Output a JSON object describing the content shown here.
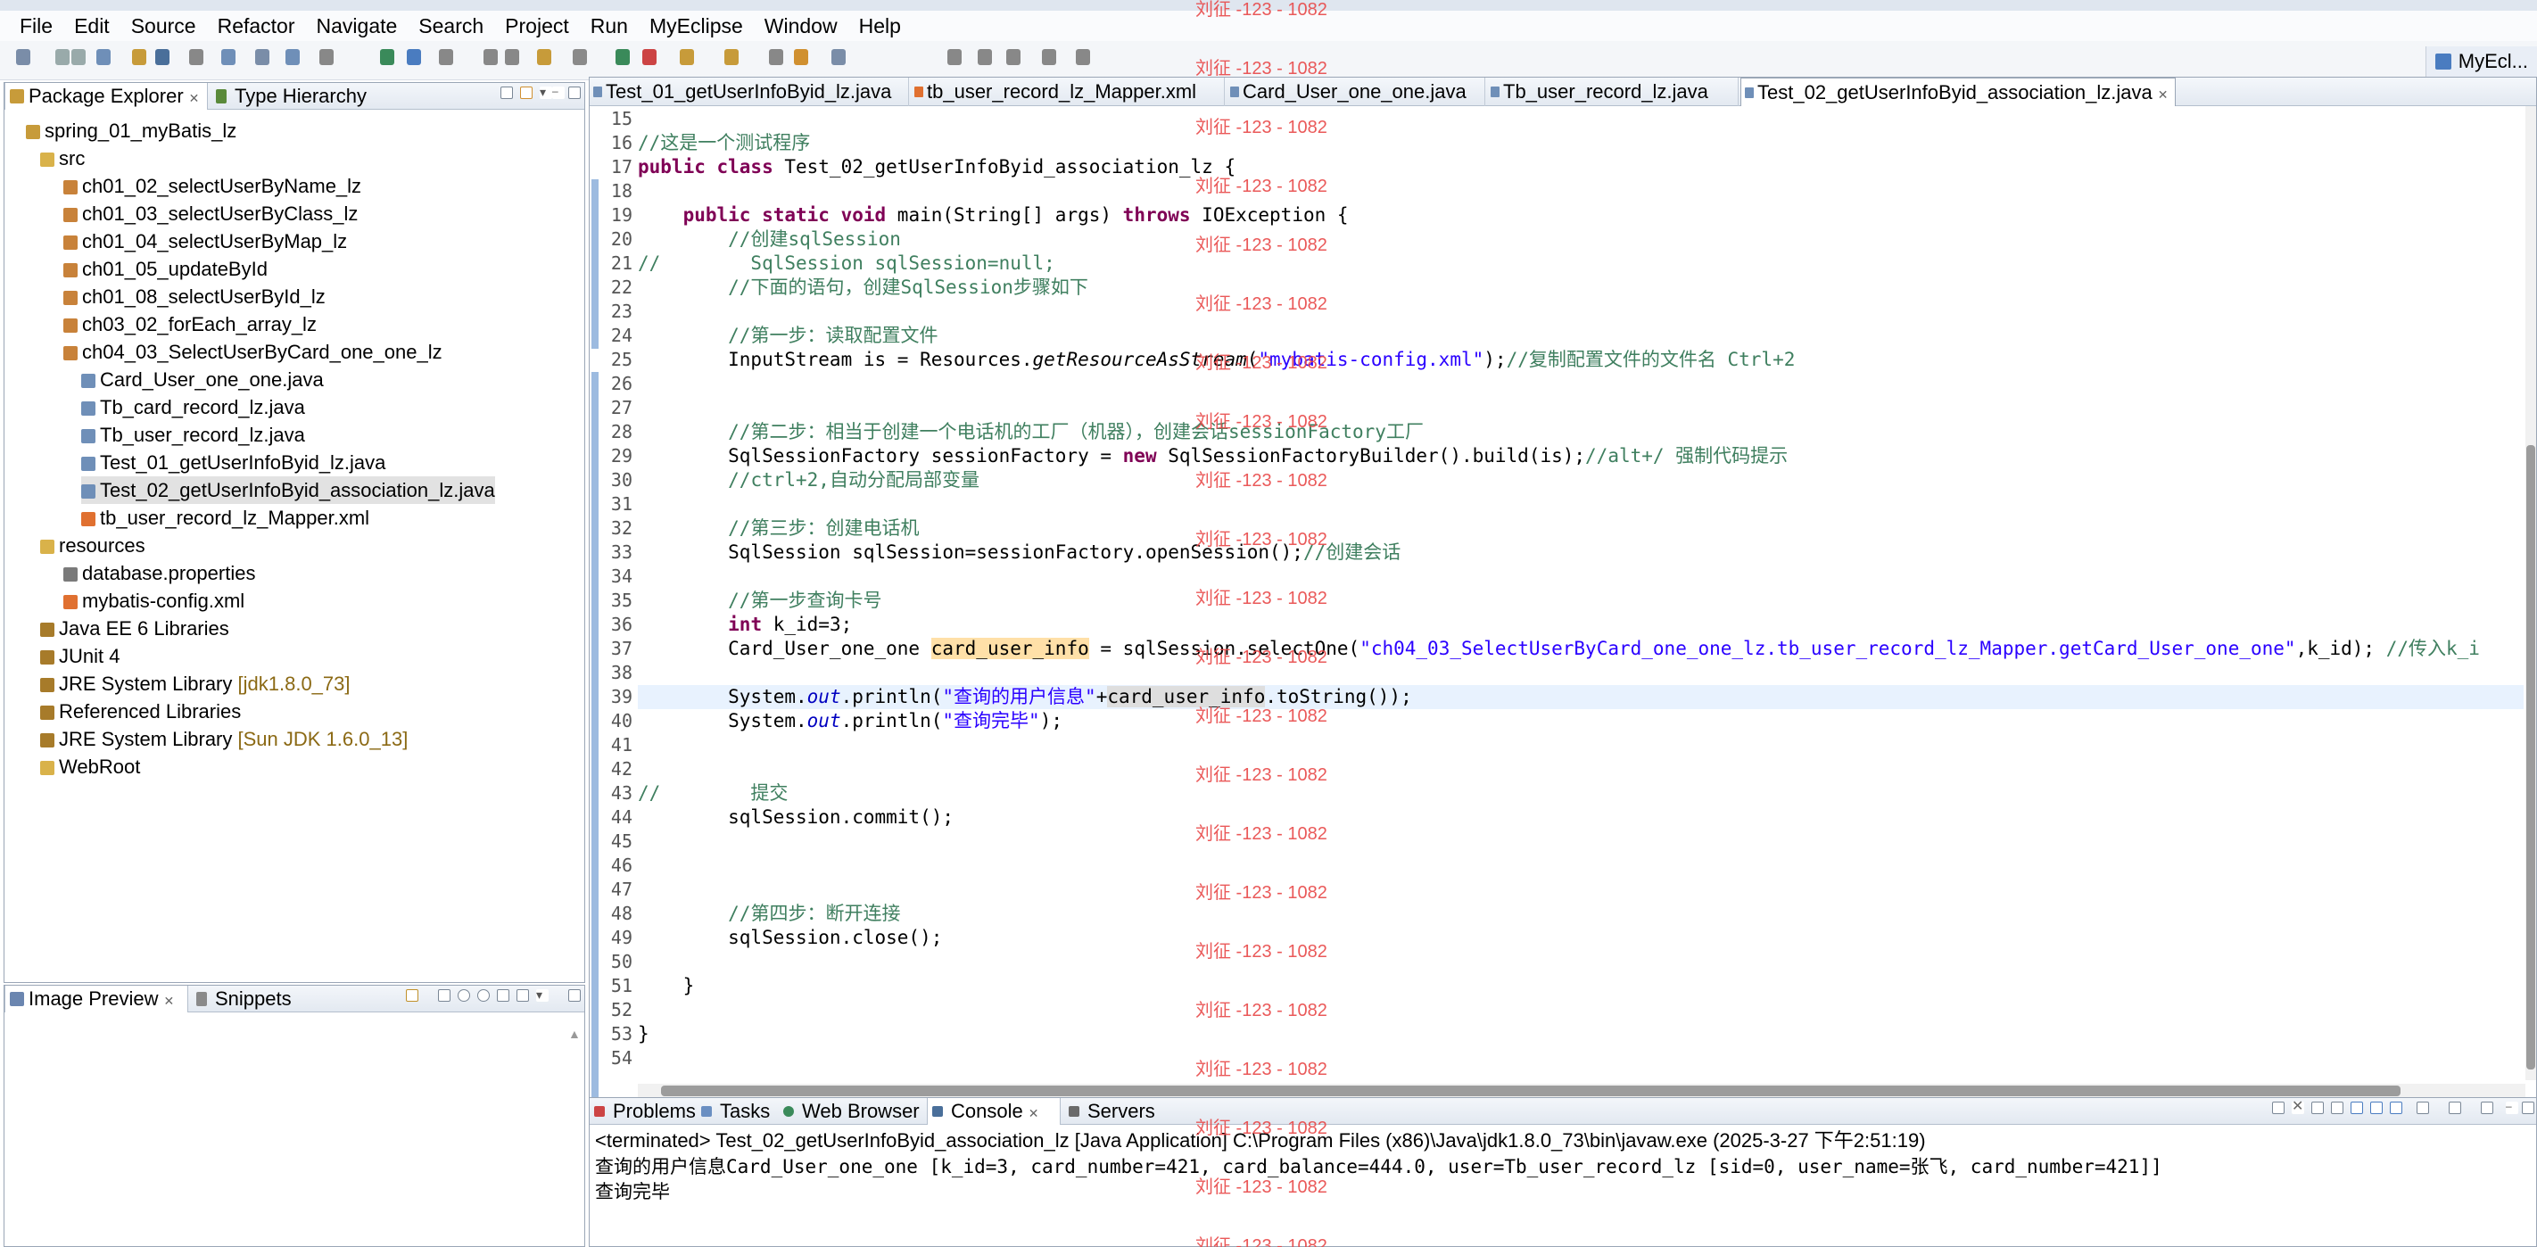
{
  "menu": [
    "File",
    "Edit",
    "Source",
    "Refactor",
    "Navigate",
    "Search",
    "Project",
    "Run",
    "MyEclipse",
    "Window",
    "Help"
  ],
  "perspective": "MyEcl...",
  "package_explorer": {
    "tabs": [
      "Package Explorer",
      "Type Hierarchy"
    ],
    "tree": [
      {
        "label": "spring_01_myBatis_lz",
        "type": "project"
      },
      {
        "label": "src",
        "type": "folder"
      },
      {
        "label": "ch01_02_selectUserByName_lz",
        "type": "package"
      },
      {
        "label": "ch01_03_selectUserByClass_lz",
        "type": "package"
      },
      {
        "label": "ch01_04_selectUserByMap_lz",
        "type": "package"
      },
      {
        "label": "ch01_05_updateById",
        "type": "package"
      },
      {
        "label": "ch01_08_selectUserById_lz",
        "type": "package"
      },
      {
        "label": "ch03_02_forEach_array_lz",
        "type": "package"
      },
      {
        "label": "ch04_03_SelectUserByCard_one_one_lz",
        "type": "package"
      },
      {
        "label": "Card_User_one_one.java",
        "type": "java"
      },
      {
        "label": "Tb_card_record_lz.java",
        "type": "java"
      },
      {
        "label": "Tb_user_record_lz.java",
        "type": "java"
      },
      {
        "label": "Test_01_getUserInfoByid_lz.java",
        "type": "java"
      },
      {
        "label": "Test_02_getUserInfoByid_association_lz.java",
        "type": "java"
      },
      {
        "label": "tb_user_record_lz_Mapper.xml",
        "type": "xml"
      },
      {
        "label": "resources",
        "type": "folder"
      },
      {
        "label": "database.properties",
        "type": "props"
      },
      {
        "label": "mybatis-config.xml",
        "type": "xml"
      },
      {
        "label": "Java EE 6 Libraries",
        "type": "lib"
      },
      {
        "label": "JUnit 4",
        "type": "lib"
      },
      {
        "label": "JRE System Library",
        "type": "lib",
        "extra": "[jdk1.8.0_73]"
      },
      {
        "label": "Referenced Libraries",
        "type": "lib"
      },
      {
        "label": "JRE System Library",
        "type": "lib",
        "extra": "[Sun JDK 1.6.0_13]"
      },
      {
        "label": "WebRoot",
        "type": "folder"
      }
    ]
  },
  "image_preview": {
    "tabs": [
      "Image Preview",
      "Snippets"
    ]
  },
  "editor": {
    "tabs": [
      "Test_01_getUserInfoByid_lz.java",
      "tb_user_record_lz_Mapper.xml",
      "Card_User_one_one.java",
      "Tb_user_record_lz.java",
      "Test_02_getUserInfoByid_association_lz.java"
    ],
    "line_numbers": [
      "15",
      "16",
      "17",
      "18",
      "19",
      "20",
      "21",
      "22",
      "23",
      "24",
      "25",
      "26",
      "27",
      "28",
      "29",
      "30",
      "31",
      "32",
      "33",
      "34",
      "35",
      "36",
      "37",
      "38",
      "39",
      "40",
      "41",
      "42",
      "43",
      "44",
      "45",
      "46",
      "47",
      "48",
      "49",
      "50",
      "51",
      "52",
      "53",
      "54"
    ]
  },
  "console": {
    "tabs": [
      "Problems",
      "Tasks",
      "Web Browser",
      "Console",
      "Servers"
    ],
    "header": "<terminated> Test_02_getUserInfoByid_association_lz [Java Application] C:\\Program Files (x86)\\Java\\jdk1.8.0_73\\bin\\javaw.exe (2025-3-27 下午2:51:19)",
    "lines": [
      "查询的用户信息Card_User_one_one [k_id=3, card_number=421, card_balance=444.0, user=Tb_user_record_lz [sid=0, user_name=张飞, card_number=421]]",
      "查询完毕"
    ]
  },
  "watermark": "刘征 -123 - 1082"
}
